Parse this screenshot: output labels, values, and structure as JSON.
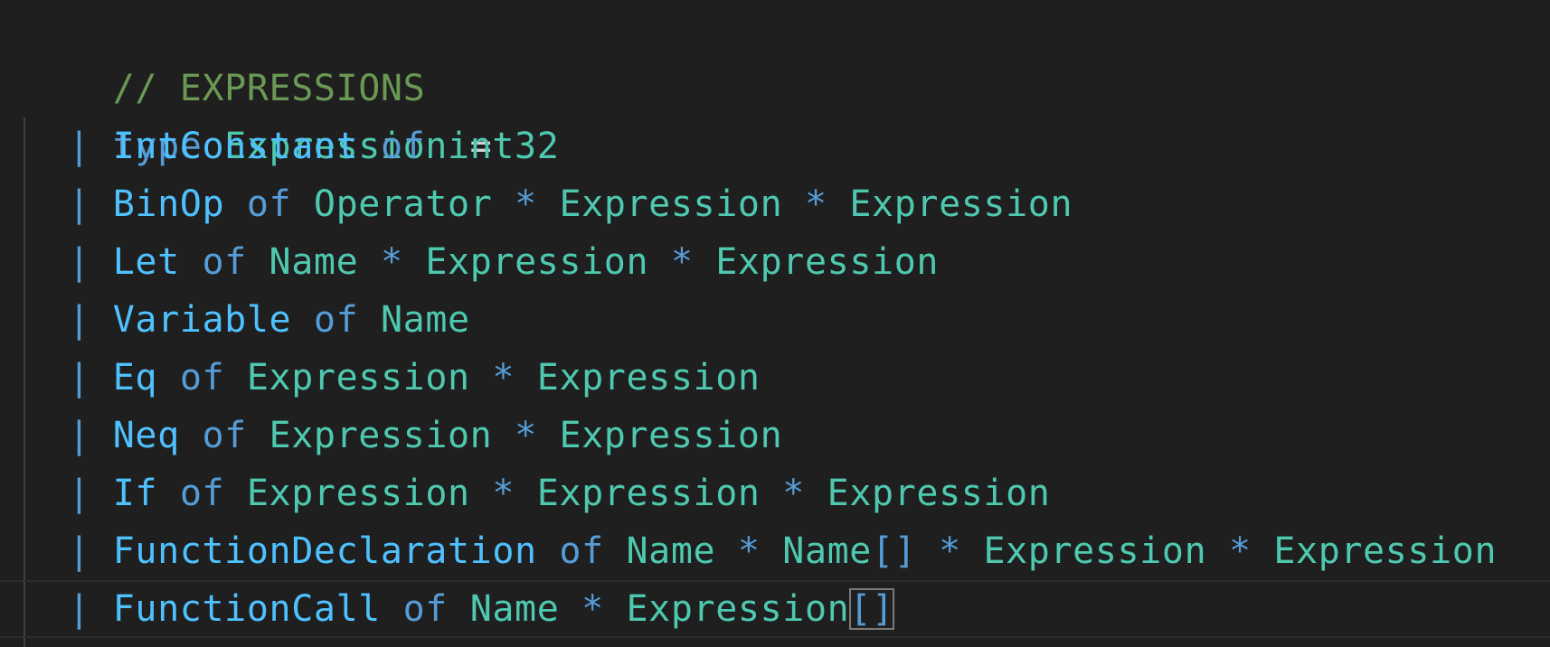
{
  "editor": {
    "lines": [
      {
        "text": "// EXPRESSIONS"
      },
      {
        "kw": "type",
        "name": "Expression",
        "eq": "="
      },
      {
        "pipe": "|",
        "ctor": "IntConstant",
        "of": "of",
        "rest": "int32"
      },
      {
        "pipe": "|",
        "ctor": "BinOp",
        "of": "of",
        "t1": "Operator",
        "s1": "*",
        "t2": "Expression",
        "s2": "*",
        "t3": "Expression"
      },
      {
        "pipe": "|",
        "ctor": "Let",
        "of": "of",
        "t1": "Name",
        "s1": "*",
        "t2": "Expression",
        "s2": "*",
        "t3": "Expression"
      },
      {
        "pipe": "|",
        "ctor": "Variable",
        "of": "of",
        "t1": "Name"
      },
      {
        "pipe": "|",
        "ctor": "Eq",
        "of": "of",
        "t1": "Expression",
        "s1": "*",
        "t2": "Expression"
      },
      {
        "pipe": "|",
        "ctor": "Neq",
        "of": "of",
        "t1": "Expression",
        "s1": "*",
        "t2": "Expression"
      },
      {
        "pipe": "|",
        "ctor": "If",
        "of": "of",
        "t1": "Expression",
        "s1": "*",
        "t2": "Expression",
        "s2": "*",
        "t3": "Expression"
      },
      {
        "pipe": "|",
        "ctor": "FunctionDeclaration",
        "of": "of",
        "t1": "Name",
        "s1": "*",
        "t2": "Name",
        "b2": "[]",
        "s2": "*",
        "t3": "Expression",
        "s3": "*",
        "t4": "Expression"
      },
      {
        "pipe": "|",
        "ctor": "FunctionCall",
        "of": "of",
        "t1": "Name",
        "s1": "*",
        "t2": "Expression",
        "b2": "[]"
      }
    ]
  }
}
